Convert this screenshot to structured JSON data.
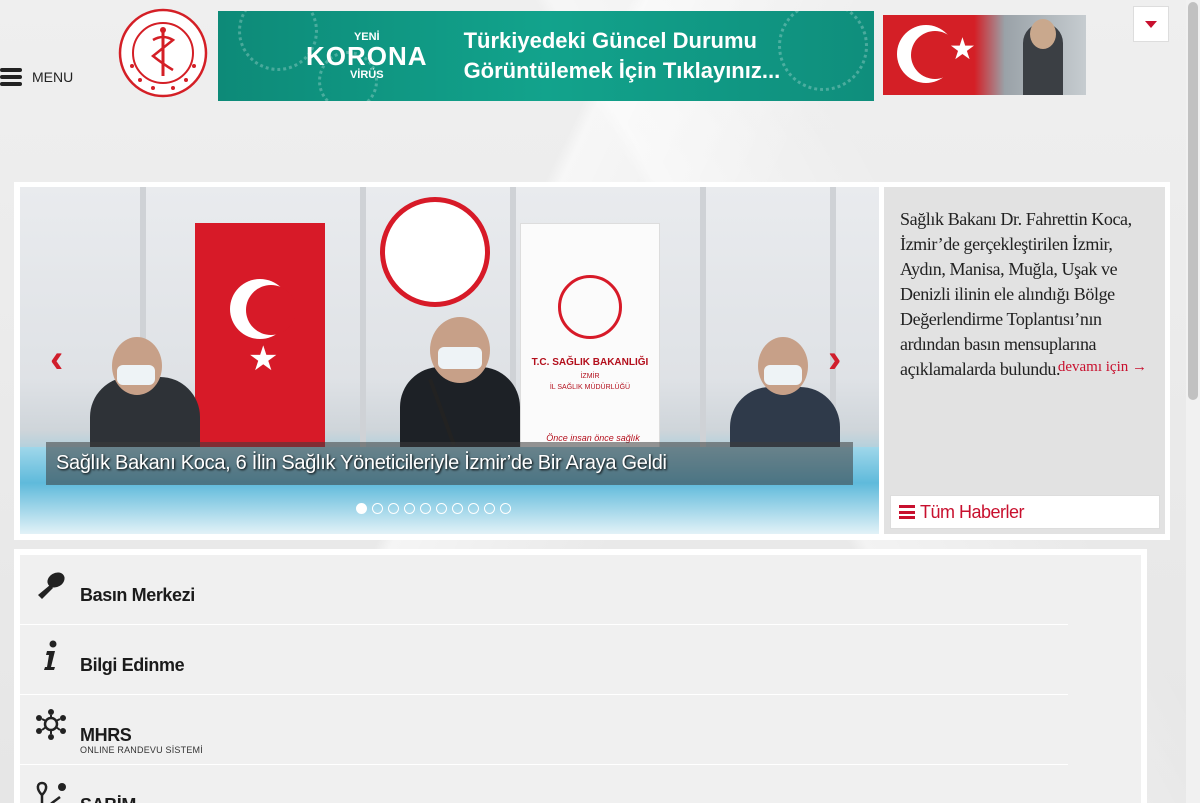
{
  "header": {
    "menu_label": "MENU",
    "korona": {
      "badge_top": "YENİ",
      "badge_main": "KORONA",
      "badge_bottom": "VİRÜS",
      "line1": "Türkiyedeki Güncel Durumu",
      "line2": "Görüntülemek İçin Tıklayınız..."
    }
  },
  "slider": {
    "caption": "Sağlık Bakanı Koca, 6 İlin Sağlık Yöneticileriyle İzmir’de Bir Araya Geldi",
    "banner_title": "T.C. SAĞLIK BAKANLIĞI",
    "banner_sub": "İZMİR",
    "banner_sub2": "İL SAĞLIK MÜDÜRLÜĞÜ",
    "banner_slogan": "Önce insan önce sağlık",
    "prev_icon": "chevron-left-icon",
    "next_icon": "chevron-right-icon",
    "dot_count": 10,
    "active_dot": 0
  },
  "news": {
    "summary": "Sağlık Bakanı Dr. Fahrettin Koca, İzmir’de gerçekleştirilen İzmir, Aydın, Manisa, Muğla, Uşak ve Denizli ilinin ele alındığı Bölge Değerlendirme Toplantısı’nın ardından basın mensuplarına açıklamalarda bulundu.",
    "more_label": "devamı için →",
    "all_news_label": "Tüm Haberler"
  },
  "quick_links": [
    {
      "label": "Basın Merkezi",
      "sub": "",
      "icon": "microphone-icon"
    },
    {
      "label": "Bilgi Edinme",
      "sub": "",
      "icon": "info-icon"
    },
    {
      "label": "MHRS",
      "sub": "ONLINE RANDEVU SİSTEMİ",
      "icon": "network-icon"
    },
    {
      "label": "SABİM",
      "sub": "",
      "icon": "route-icon"
    }
  ],
  "colors": {
    "brand_red": "#c8102e",
    "korona_teal": "#12a38c",
    "panel_gray": "#e2e2e2"
  }
}
